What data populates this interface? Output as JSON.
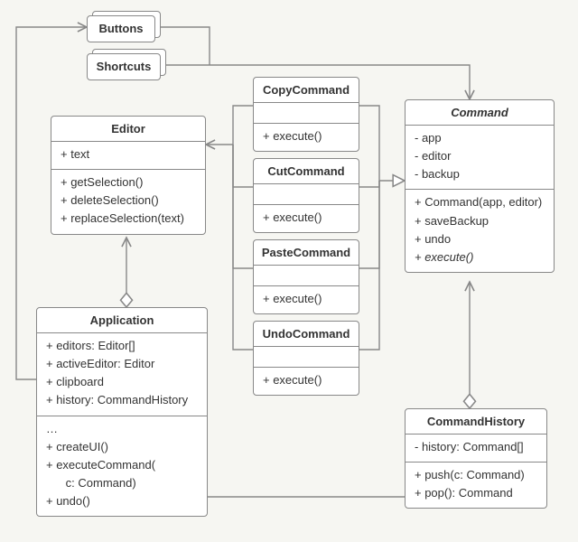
{
  "buttons": {
    "label": "Buttons"
  },
  "shortcuts": {
    "label": "Shortcuts"
  },
  "copyCommand": {
    "title": "CopyCommand",
    "method": "+ execute()"
  },
  "cutCommand": {
    "title": "CutCommand",
    "method": "+ execute()"
  },
  "pasteCommand": {
    "title": "PasteCommand",
    "method": "+ execute()"
  },
  "undoCommand": {
    "title": "UndoCommand",
    "method": "+ execute()"
  },
  "editor": {
    "title": "Editor",
    "field1": "+ text",
    "m1": "+ getSelection()",
    "m2": "+ deleteSelection()",
    "m3": "+ replaceSelection(text)"
  },
  "application": {
    "title": "Application",
    "f1": "+ editors: Editor[]",
    "f2": "+ activeEditor: Editor",
    "f3": "+ clipboard",
    "f4": "+ history: CommandHistory",
    "m0": "…",
    "m1": "+ createUI()",
    "m2": "+ executeCommand(",
    "m2b": "      c: Command)",
    "m3": "+ undo()"
  },
  "command": {
    "title": "Command",
    "f1": "- app",
    "f2": "- editor",
    "f3": "- backup",
    "m1": "+ Command(app, editor)",
    "m2": "+ saveBackup",
    "m3": "+ undo",
    "m4": "+ execute()"
  },
  "commandHistory": {
    "title": "CommandHistory",
    "f1": "- history: Command[]",
    "m1": "+ push(c: Command)",
    "m2": "+ pop(): Command"
  }
}
